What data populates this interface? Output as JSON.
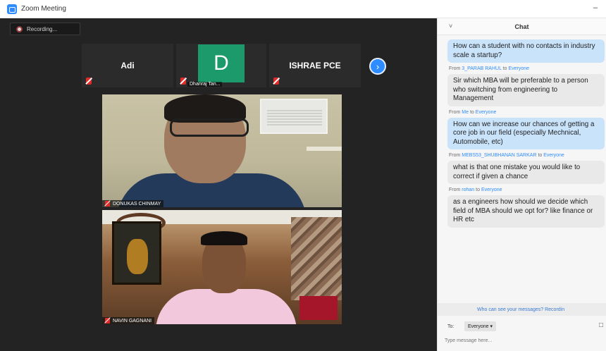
{
  "window": {
    "title": "Zoom Meeting",
    "minimize_glyph": "–"
  },
  "recording": {
    "label": "Recording..."
  },
  "tiles": [
    {
      "name": "Adi"
    },
    {
      "initial": "D",
      "label": "Dhanraj Tan..."
    },
    {
      "name": "ISHRAE PCE"
    }
  ],
  "next_button_glyph": "›",
  "videos": [
    {
      "label": "DONUKAS CHINMAY"
    },
    {
      "label": "NAVIN GAGNANI"
    }
  ],
  "chat": {
    "collapse_glyph": "˅",
    "header": "Chat",
    "messages": [
      {
        "text": "How can a student with no contacts in industry scale a startup?"
      },
      {
        "sender_from": "From",
        "sender_name": "3_PARAB RAHUL",
        "sender_to": "to",
        "sender_target": "Everyone",
        "text": "Sir which MBA will be preferable to a person who switching from engineering to Management"
      },
      {
        "sender_from": "From",
        "sender_name": "Me",
        "sender_to": "to",
        "sender_target": "Everyone",
        "text": "How can we increase our chances of getting a core job in our field (especially Mechnical, Automobile, etc)"
      },
      {
        "sender_from": "From",
        "sender_name": "MEBS53_SHUBHANAN SARKAR",
        "sender_to": "to",
        "sender_target": "Everyone",
        "text": "what is that one mistake you would like to correct if given a chance"
      },
      {
        "sender_from": "From",
        "sender_name": "rohan",
        "sender_to": "to",
        "sender_target": "Everyone",
        "text": "as a engineers how should we decide which field of MBA should we opt for? like finance or HR etc"
      }
    ],
    "privacy_notice": "Who can see your messages? Recordin",
    "to_label": "To:",
    "to_value": "Everyone ▾",
    "input_placeholder": "Type message here..."
  }
}
